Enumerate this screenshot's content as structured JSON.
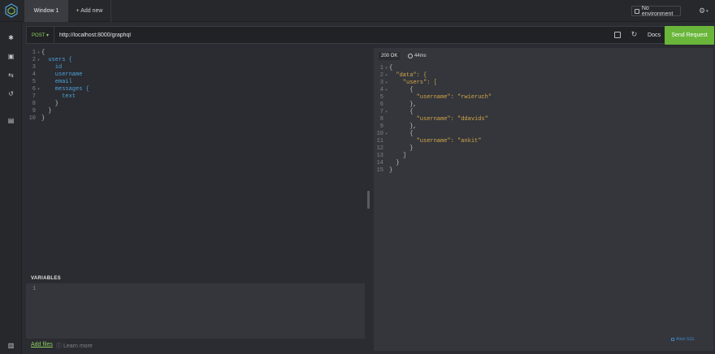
{
  "window": {
    "tab_label": "Window 1",
    "add_new_label": "+ Add new",
    "environment_label": "No environment"
  },
  "request": {
    "method": "POST ▾",
    "url": "http://localhost:8000/graphql",
    "docs_label": "Docs",
    "send_label": "Send Request"
  },
  "query_lines": [
    {
      "n": "1",
      "fold": "▾",
      "code": "{"
    },
    {
      "n": "2",
      "fold": "▾",
      "code": "  users {"
    },
    {
      "n": "3",
      "fold": "",
      "code": "    id"
    },
    {
      "n": "4",
      "fold": "",
      "code": "    username"
    },
    {
      "n": "5",
      "fold": "",
      "code": "    email"
    },
    {
      "n": "6",
      "fold": "▾",
      "code": "    messages {"
    },
    {
      "n": "7",
      "fold": "",
      "code": "      text"
    },
    {
      "n": "8",
      "fold": "",
      "code": "    }"
    },
    {
      "n": "9",
      "fold": "",
      "code": "  }"
    },
    {
      "n": "10",
      "fold": "",
      "code": "}"
    }
  ],
  "variables": {
    "title": "VARIABLES",
    "line_number": "1",
    "add_files_label": "Add files",
    "learn_more_label": "Learn more"
  },
  "response": {
    "status": "200 OK",
    "time": "44ms",
    "footer": "Altair GQL",
    "lines": [
      {
        "n": "1",
        "fold": "▾",
        "code": "{"
      },
      {
        "n": "2",
        "fold": "▾",
        "code": "  \"data\": {"
      },
      {
        "n": "3",
        "fold": "▾",
        "code": "    \"users\": ["
      },
      {
        "n": "4",
        "fold": "▾",
        "code": "      {"
      },
      {
        "n": "5",
        "fold": "",
        "code": "        \"username\": \"rwieruch\""
      },
      {
        "n": "6",
        "fold": "",
        "code": "      },"
      },
      {
        "n": "7",
        "fold": "▾",
        "code": "      {"
      },
      {
        "n": "8",
        "fold": "",
        "code": "        \"username\": \"ddavids\""
      },
      {
        "n": "9",
        "fold": "",
        "code": "      },"
      },
      {
        "n": "10",
        "fold": "▾",
        "code": "      {"
      },
      {
        "n": "11",
        "fold": "",
        "code": "        \"username\": \"ankit\""
      },
      {
        "n": "12",
        "fold": "",
        "code": "      }"
      },
      {
        "n": "13",
        "fold": "",
        "code": "    ]"
      },
      {
        "n": "14",
        "fold": "",
        "code": "  }"
      },
      {
        "n": "15",
        "fold": "",
        "code": "}"
      }
    ]
  },
  "sidebar": {
    "icons": [
      "gear-icon",
      "printer-icon",
      "swap-icon",
      "history-icon",
      "collection-icon",
      "document-icon"
    ]
  },
  "colors": {
    "accent": "#69b63a",
    "background": "#2a2c31",
    "keyword": "#4fa0d9",
    "string": "#d4a64a"
  }
}
